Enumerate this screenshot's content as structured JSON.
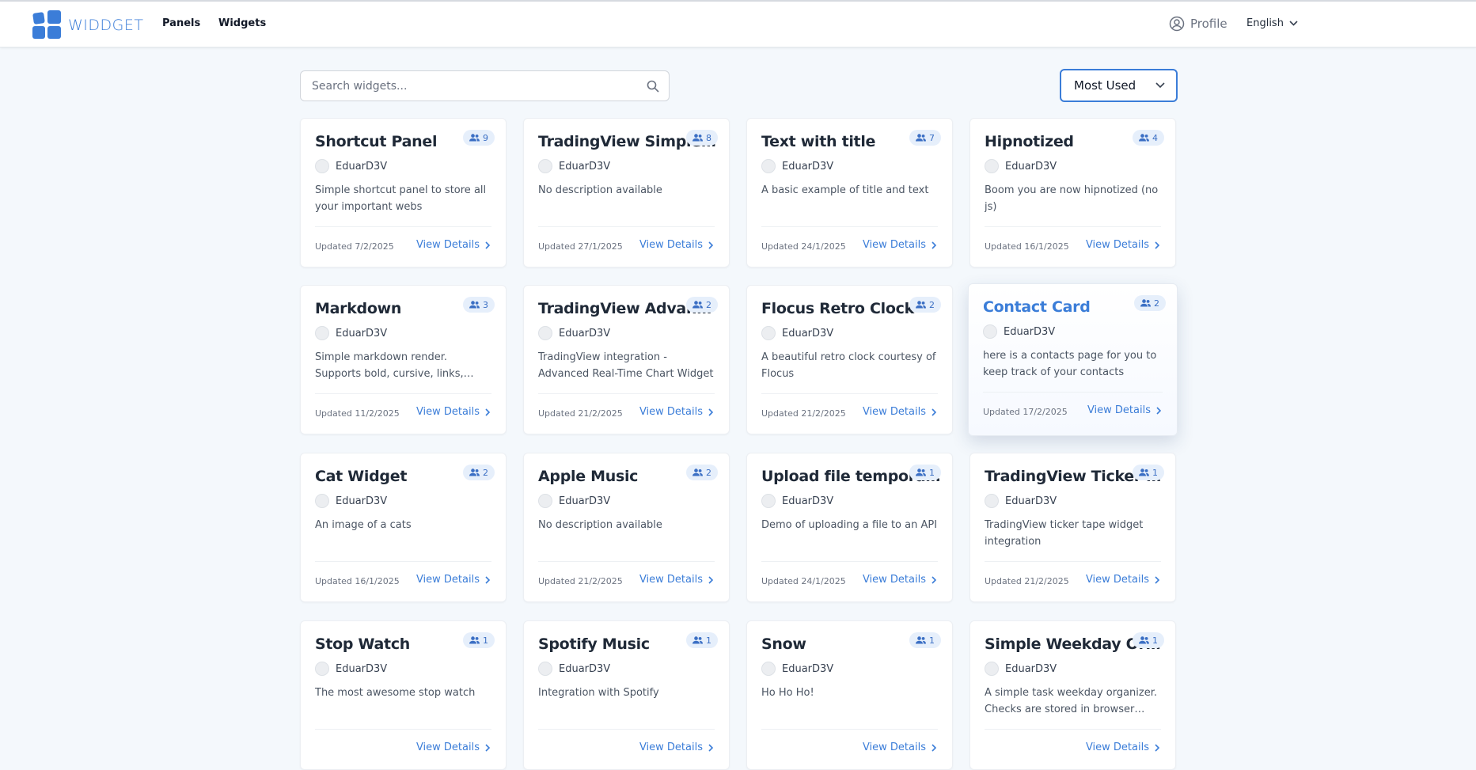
{
  "app": {
    "brand": "WIDDGET",
    "accent": "#3b7dd8",
    "nav": {
      "panels": "Panels",
      "widgets": "Widgets"
    },
    "profile": "Profile",
    "language": "English"
  },
  "search": {
    "placeholder": "Search widgets...",
    "value": ""
  },
  "sort": {
    "selected": "Most Used"
  },
  "labels": {
    "view_details": "View Details"
  },
  "widgets": [
    {
      "title": "Shortcut Panel",
      "users": "9",
      "author": "EduarD3V",
      "description": "Simple shortcut panel to store all your important webs",
      "updated": "Updated 7/2/2025"
    },
    {
      "title": "TradingView Simple Chart",
      "users": "8",
      "author": "EduarD3V",
      "description": "No description available",
      "updated": "Updated 27/1/2025"
    },
    {
      "title": "Text with title",
      "users": "7",
      "author": "EduarD3V",
      "description": "A basic example of title and text",
      "updated": "Updated 24/1/2025"
    },
    {
      "title": "Hipnotized",
      "users": "4",
      "author": "EduarD3V",
      "description": "Boom you are now hipnotized (no js)",
      "updated": "Updated 16/1/2025"
    },
    {
      "title": "Markdown",
      "users": "3",
      "author": "EduarD3V",
      "description": "Simple markdown render. Supports bold, cursive, links, inline code and more",
      "updated": "Updated 11/2/2025"
    },
    {
      "title": "TradingView Advanced Chart",
      "users": "2",
      "author": "EduarD3V",
      "description": "TradingView integration - Advanced Real-Time Chart Widget",
      "updated": "Updated 21/2/2025"
    },
    {
      "title": "Flocus Retro Clock",
      "users": "2",
      "author": "EduarD3V",
      "description": "A beautiful retro clock courtesy of Flocus",
      "updated": "Updated 21/2/2025"
    },
    {
      "title": "Contact Card",
      "users": "2",
      "author": "EduarD3V",
      "description": "here is a contacts page for you to keep track of your contacts",
      "updated": "Updated 17/2/2025"
    },
    {
      "title": "Cat Widget",
      "users": "2",
      "author": "EduarD3V",
      "description": "An image of a cats",
      "updated": "Updated 16/1/2025"
    },
    {
      "title": "Apple Music",
      "users": "2",
      "author": "EduarD3V",
      "description": "No description available",
      "updated": "Updated 21/2/2025"
    },
    {
      "title": "Upload file temporary",
      "users": "1",
      "author": "EduarD3V",
      "description": "Demo of uploading a file to an API",
      "updated": "Updated 24/1/2025"
    },
    {
      "title": "TradingView Ticker Tape",
      "users": "1",
      "author": "EduarD3V",
      "description": "TradingView ticker tape widget integration",
      "updated": "Updated 21/2/2025"
    },
    {
      "title": "Stop Watch",
      "users": "1",
      "author": "EduarD3V",
      "description": "The most awesome stop watch",
      "updated": ""
    },
    {
      "title": "Spotify Music",
      "users": "1",
      "author": "EduarD3V",
      "description": "Integration with Spotify",
      "updated": ""
    },
    {
      "title": "Snow",
      "users": "1",
      "author": "EduarD3V",
      "description": "Ho Ho Ho!",
      "updated": ""
    },
    {
      "title": "Simple Weekday Organizer",
      "users": "1",
      "author": "EduarD3V",
      "description": "A simple task weekday organizer. Checks are stored in browser storage",
      "updated": ""
    }
  ]
}
